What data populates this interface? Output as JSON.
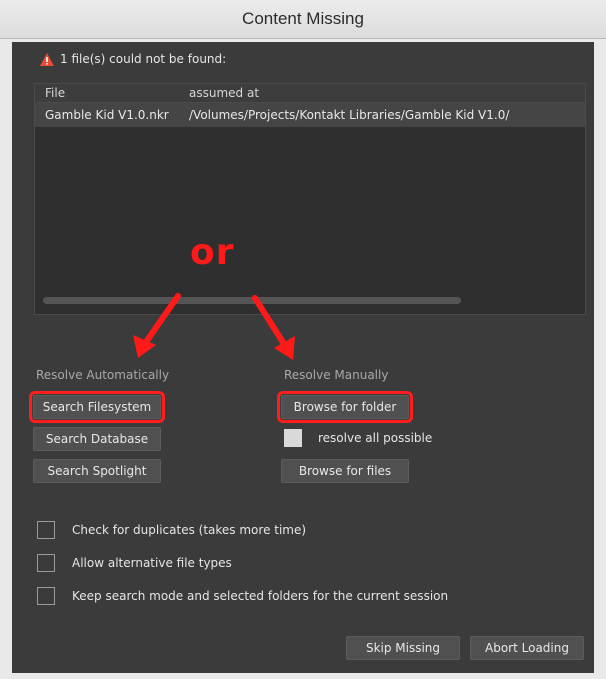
{
  "window": {
    "title": "Content Missing"
  },
  "warning": {
    "icon": "warning-triangle-icon",
    "text": "1 file(s) could not be found:",
    "color": "#e94b35"
  },
  "list": {
    "columns": [
      "File",
      "assumed at"
    ],
    "rows": [
      {
        "file": "Gamble Kid V1.0.nkr",
        "path": "/Volumes/Projects/Kontakt Libraries/Gamble Kid V1.0/"
      }
    ]
  },
  "annotation": {
    "or_label": "or",
    "color": "#ff1a1a"
  },
  "resolve_auto": {
    "label": "Resolve Automatically",
    "search_filesystem": "Search Filesystem",
    "search_database": "Search Database",
    "search_spotlight": "Search Spotlight"
  },
  "resolve_manual": {
    "label": "Resolve Manually",
    "browse_folder": "Browse for folder",
    "resolve_all": "resolve all possible",
    "browse_files": "Browse for files"
  },
  "options": {
    "check_duplicates": "Check for duplicates (takes more time)",
    "allow_alternative": "Allow alternative file types",
    "keep_mode": "Keep search mode and selected folders for the current session"
  },
  "footer": {
    "skip": "Skip Missing",
    "abort": "Abort Loading"
  }
}
